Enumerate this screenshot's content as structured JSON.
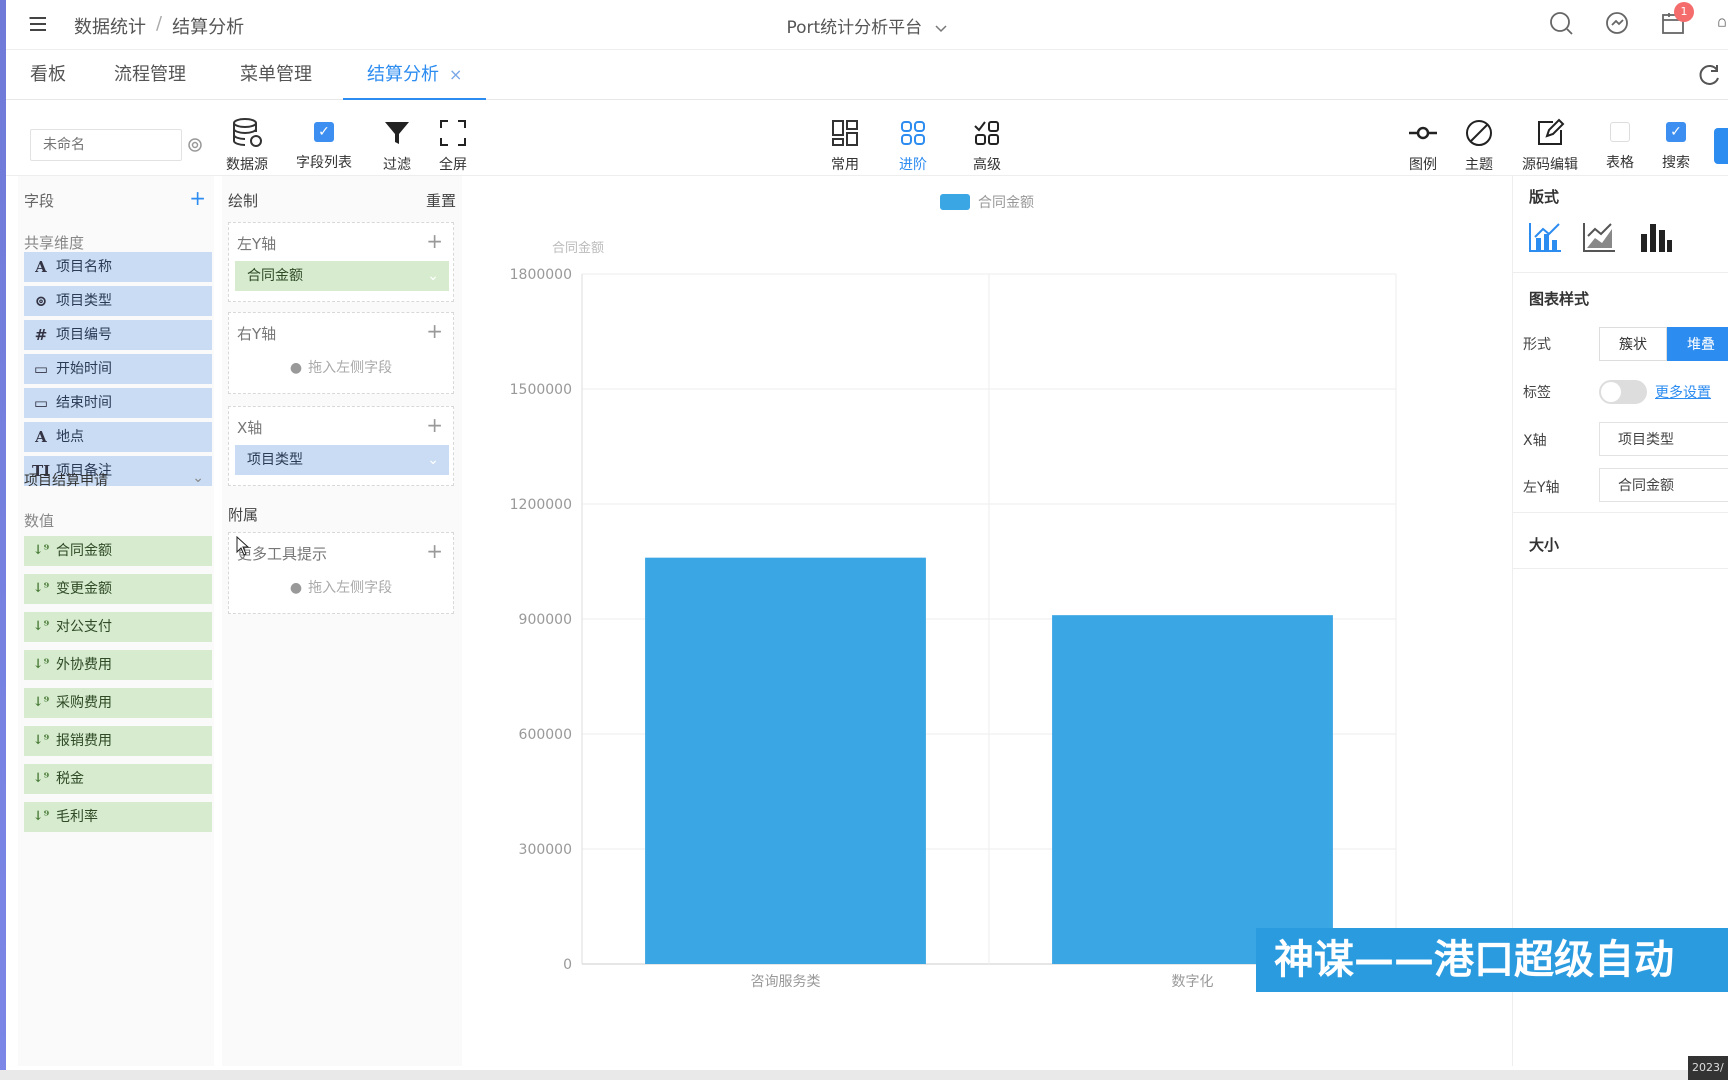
{
  "breadcrumb": {
    "root": "数据统计",
    "sep": "/",
    "current": "结算分析"
  },
  "platform": {
    "name": "Port统计分析平台"
  },
  "header": {
    "notification_count": "1"
  },
  "tabs": [
    {
      "label": "看板"
    },
    {
      "label": "流程管理"
    },
    {
      "label": "菜单管理"
    },
    {
      "label": "结算分析",
      "close": "×"
    }
  ],
  "toolbar": {
    "name_placeholder": "未命名",
    "datasource": "数据源",
    "field_list": "字段列表",
    "filter": "过滤",
    "fullscreen": "全屏",
    "common": "常用",
    "advanced": "进阶",
    "senior": "高级",
    "legend": "图例",
    "theme": "主题",
    "source_edit": "源码编辑",
    "table": "表格",
    "search": "搜索"
  },
  "fields": {
    "title": "字段",
    "plus": "+",
    "shared_dims": "共享维度",
    "dimensions": [
      {
        "icon": "A",
        "label": "项目名称"
      },
      {
        "icon": "⊚",
        "label": "项目类型"
      },
      {
        "icon": "#",
        "label": "项目编号"
      },
      {
        "icon": "▭",
        "label": "开始时间"
      },
      {
        "icon": "▭",
        "label": "结束时间"
      },
      {
        "icon": "A",
        "label": "地点"
      },
      {
        "icon": "TI",
        "label": "项目备注"
      }
    ],
    "table_name": "项目结算申请",
    "table_chevron": "⌄",
    "measures_title": "数值",
    "measures": [
      {
        "icon": "↓⁹",
        "label": "合同金额"
      },
      {
        "icon": "↓⁹",
        "label": "变更金额"
      },
      {
        "icon": "↓⁹",
        "label": "对公支付"
      },
      {
        "icon": "↓⁹",
        "label": "外协费用"
      },
      {
        "icon": "↓⁹",
        "label": "采购费用"
      },
      {
        "icon": "↓⁹",
        "label": "报销费用"
      },
      {
        "icon": "↓⁹",
        "label": "税金"
      },
      {
        "icon": "↓⁹",
        "label": "毛利率"
      }
    ]
  },
  "draw": {
    "title": "绘制",
    "reset": "重置",
    "left_y": "左Y轴",
    "left_y_value": "合同金额",
    "right_y": "右Y轴",
    "drag_hint": "拖入左侧字段",
    "x_axis": "X轴",
    "x_axis_value": "项目类型",
    "extra": "附属",
    "tooltip": "更多工具提示",
    "add": "+",
    "chevron": "⌄",
    "info": "●"
  },
  "chart_data": {
    "type": "bar",
    "categories": [
      "咨询服务类",
      "数字化"
    ],
    "series": [
      {
        "name": "合同金额",
        "values": [
          1060000,
          910000
        ],
        "color": "#3aa6e3"
      }
    ],
    "ylabel": "合同金额",
    "ylim": [
      0,
      1800000
    ],
    "yticks": [
      "0",
      "300000",
      "600000",
      "900000",
      "1200000",
      "1500000",
      "1800000"
    ],
    "legend": "top-center",
    "grid": true
  },
  "right_panel": {
    "layout_title": "版式",
    "style_title": "图表样式",
    "form_label": "形式",
    "form_options": [
      "簇状",
      "堆叠"
    ],
    "form_selected": "堆叠",
    "label_label": "标签",
    "more_settings": "更多设置",
    "x_axis_label": "X轴",
    "x_axis_value": "项目类型",
    "left_y_label": "左Y轴",
    "left_y_value": "合同金额",
    "size_title": "大小"
  },
  "overlay": {
    "caption": "神谋——港口超级自动"
  },
  "clock": {
    "text": "2023/"
  },
  "colors": {
    "accent": "#2d8cf0",
    "bar": "#3aa6e3",
    "dim_field": "#c9dcf3",
    "num_field": "#d7ebcf"
  }
}
